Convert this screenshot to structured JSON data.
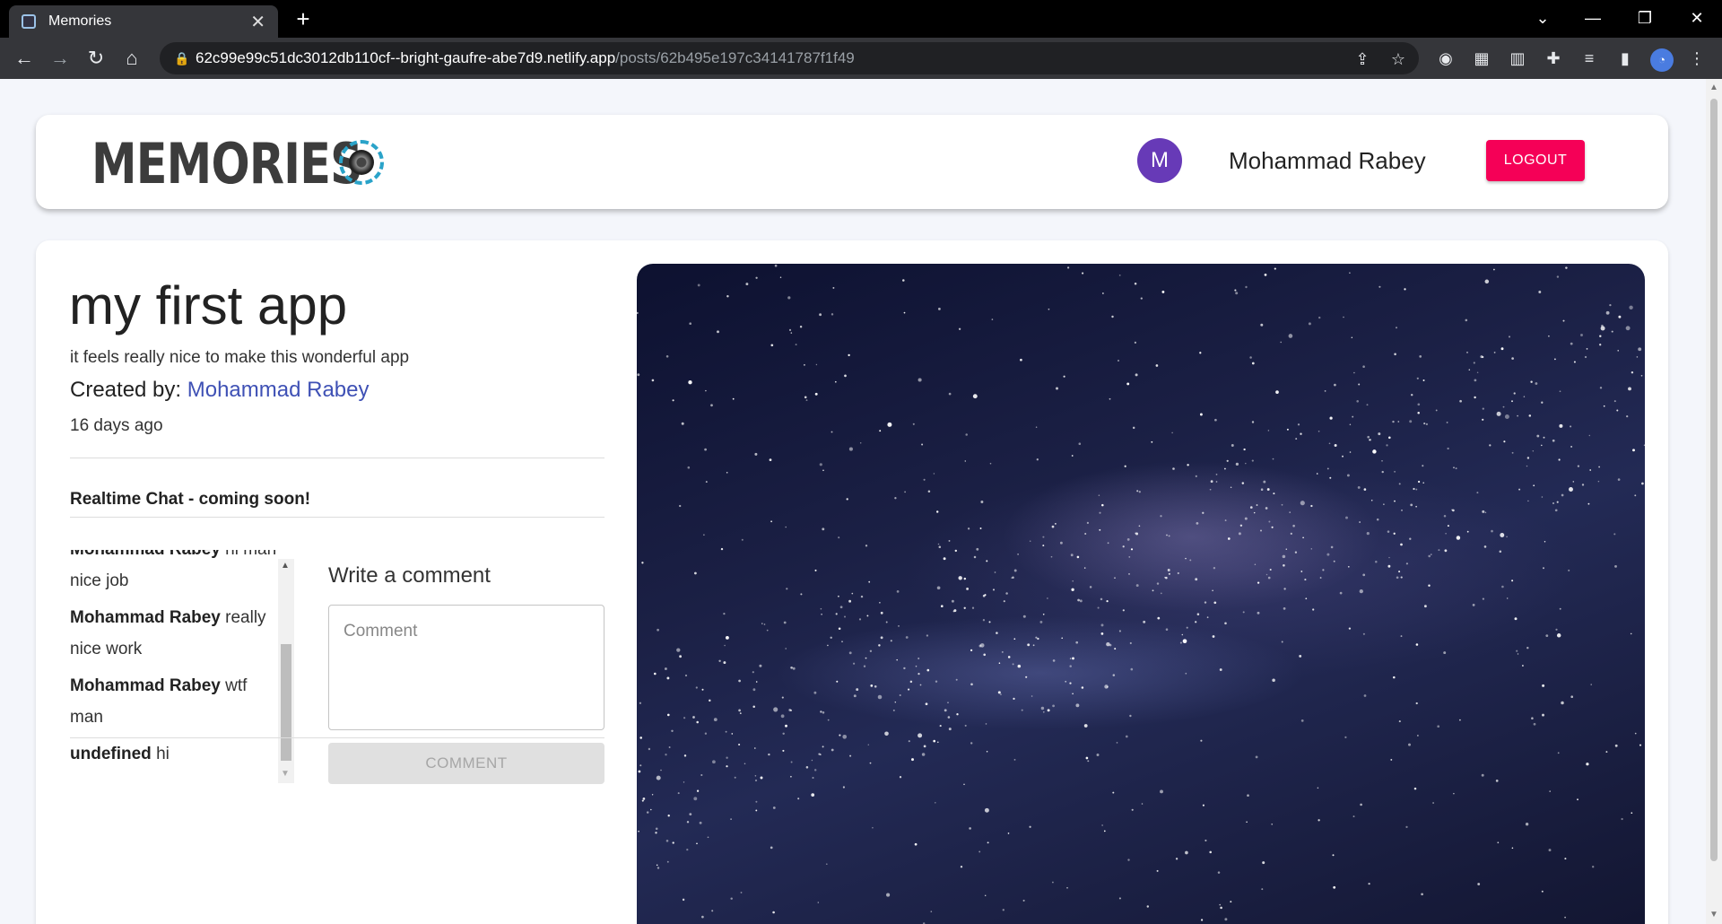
{
  "browser": {
    "tab_title": "Memories",
    "url_host": "62c99e99c51dc3012db110cf--bright-gaufre-abe7d9.netlify.app",
    "url_path": "/posts/62b495e197c34141787f1f49"
  },
  "header": {
    "brand": "MEMORIES",
    "avatar_letter": "M",
    "user_name": "Mohammad Rabey",
    "logout_label": "LOGOUT"
  },
  "post": {
    "title": "my first app",
    "message": "it feels really nice to make this wonderful app",
    "created_by_label": "Created by: ",
    "creator": "Mohammad Rabey",
    "time": "16 days ago",
    "chat_note": "Realtime Chat - coming soon!",
    "image_alt": "starry night sky with milky way"
  },
  "comments": {
    "items": [
      {
        "author": "Mohammad Rabey",
        "text": "hi man nice job"
      },
      {
        "author": "Mohammad Rabey",
        "text": "really nice work"
      },
      {
        "author": "Mohammad Rabey",
        "text": "wtf man"
      },
      {
        "author": "undefined",
        "text": "hi"
      }
    ],
    "write_label": "Write a comment",
    "placeholder": "Comment",
    "button_label": "COMMENT"
  },
  "icons": [
    "back-icon",
    "forward-icon",
    "reload-icon",
    "home-icon",
    "lock-icon",
    "share-icon",
    "star-icon",
    "extension-icon",
    "reading-list-icon",
    "side-panel-icon",
    "menu-icon",
    "close-icon",
    "plus-icon",
    "minimize-icon",
    "restore-icon",
    "camera-lens-icon"
  ],
  "colors": {
    "accent": "#f50057",
    "avatar": "#673ab7",
    "link": "#3f51b5"
  }
}
